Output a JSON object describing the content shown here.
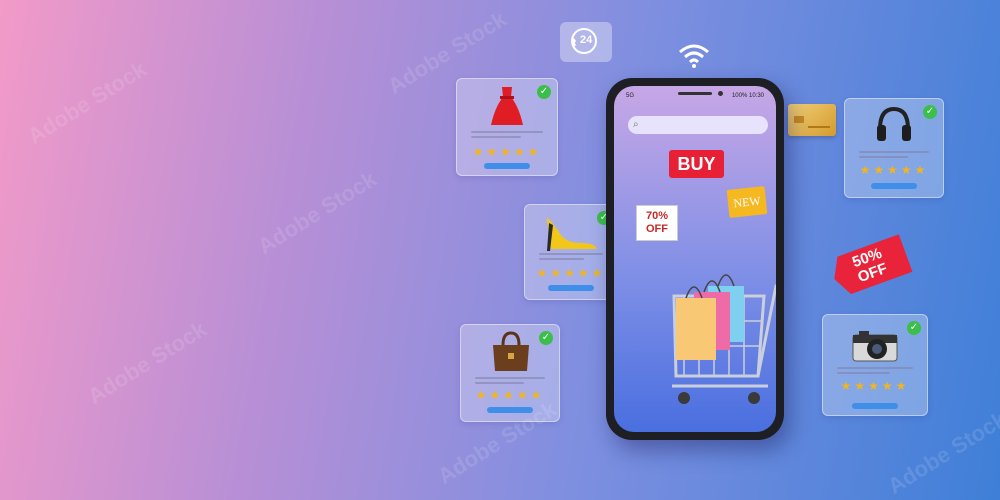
{
  "watermark": "Adobe Stock",
  "support_badge": {
    "text": "24",
    "icon": "phone-24h-icon"
  },
  "wifi_icon": "wifi-icon",
  "phone": {
    "status": {
      "network": "5G",
      "battery": "100%",
      "time": "10:30"
    },
    "search_icon": "search-icon",
    "buy_label": "BUY",
    "new_label": "NEW"
  },
  "tags": {
    "seventy_off_pct": "70%",
    "seventy_off_word": "OFF",
    "fifty_off_pct": "50%",
    "fifty_off_word": "OFF"
  },
  "product_cards": [
    {
      "item": "dress",
      "stars": "★★★★★"
    },
    {
      "item": "high-heel-shoe",
      "stars": "★★★★★"
    },
    {
      "item": "handbag",
      "stars": "★★★★★"
    },
    {
      "item": "headphones",
      "stars": "★★★★★"
    },
    {
      "item": "camera",
      "stars": "★★★★★"
    }
  ],
  "colors": {
    "buy": "#e82036",
    "sale_tag": "#e8233a",
    "new_tag": "#f5b820",
    "check": "#3bbf4a",
    "button": "#3f8fe8"
  }
}
